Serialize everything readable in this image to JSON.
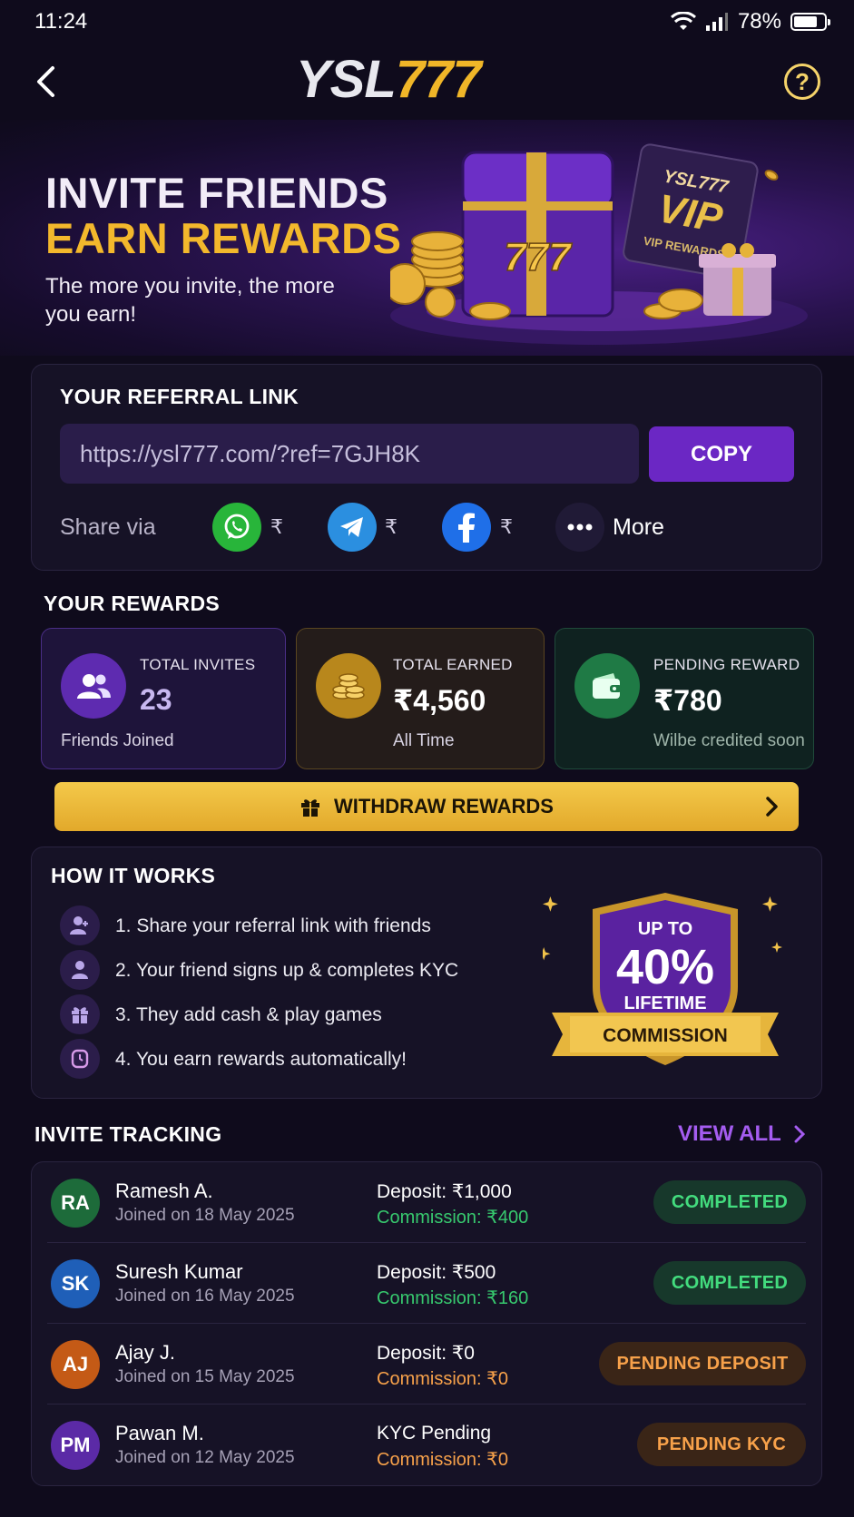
{
  "status_bar": {
    "time": "11:24",
    "battery": "78%",
    "battery_level": 0.78
  },
  "header": {
    "logo_part1": "YSL",
    "logo_part2": "777",
    "help_label": "?"
  },
  "hero": {
    "title_line1": "INVITE FRIENDS",
    "title_line2": "EARN REWARDS",
    "subtitle": "The more you invite, the more you earn!",
    "art_text": {
      "chest": "777",
      "card_brand": "YSL777",
      "card_vip": "VIP",
      "card_sub": "VIP REWARDS"
    }
  },
  "referral": {
    "title": "YOUR REFERRAL LINK",
    "link": "https://ysl777.com/?ref=7GJH8K",
    "copy_label": "COPY",
    "share_label": "Share via",
    "share_tag": "₹",
    "more_label": "More"
  },
  "rewards": {
    "title": "YOUR REWARDS",
    "cards": [
      {
        "label": "TOTAL INVITES",
        "value": "23",
        "foot": "Friends Joined"
      },
      {
        "label": "TOTAL EARNED",
        "value": "₹4,560",
        "foot": "All Time"
      },
      {
        "label": "PENDING REWARD",
        "value": "₹780",
        "foot": "Wilbe credited soon"
      }
    ],
    "withdraw_label": "WITHDRAW REWARDS"
  },
  "how": {
    "title": "HOW IT WORKS",
    "steps": [
      "1. Share your referral link with friends",
      "2. Your friend signs up & completes KYC",
      "3. They add cash & play games",
      "4. You earn rewards automatically!"
    ],
    "badge": {
      "top": "UP TO",
      "percent": "40%",
      "lifetime": "LIFETIME",
      "commission": "COMMISSION"
    }
  },
  "tracking": {
    "title": "INVITE TRACKING",
    "view_all": "VIEW ALL",
    "rows": [
      {
        "initials": "RA",
        "name": "Ramesh A.",
        "joined": "Joined on 18 May 2025",
        "deposit": "Deposit: ₹1,000",
        "commission": "Commission: ₹400",
        "status": "COMPLETED",
        "avatar_color": "#1d6b3a"
      },
      {
        "initials": "SK",
        "name": "Suresh Kumar",
        "joined": "Joined on 16 May 2025",
        "deposit": "Deposit: ₹500",
        "commission": "Commission: ₹160",
        "status": "COMPLETED",
        "avatar_color": "#1f5fb8"
      },
      {
        "initials": "AJ",
        "name": "Ajay J.",
        "joined": "Joined on 15 May 2025",
        "deposit": "Deposit: ₹0",
        "commission": "Commission: ₹0",
        "status": "PENDING DEPOSIT",
        "avatar_color": "#c45a16"
      },
      {
        "initials": "PM",
        "name": "Pawan M.",
        "joined": "Joined on 12 May 2025",
        "deposit": "KYC Pending",
        "commission": "Commission: ₹0",
        "status": "PENDING KYC",
        "avatar_color": "#5b2aa6"
      }
    ]
  },
  "colors": {
    "accent_purple": "#6b27c4",
    "gold": "#f3b82c",
    "green": "#43dc7e",
    "orange": "#f7a14a",
    "background": "#0f0b1c"
  },
  "icons": [
    "wifi-icon",
    "signal-icon",
    "battery-icon",
    "back-icon",
    "help-icon",
    "whatsapp-icon",
    "telegram-icon",
    "facebook-icon",
    "more-icon",
    "users-icon",
    "coins-icon",
    "wallet-icon",
    "gift-icon",
    "chevron-right-icon",
    "user-add-icon",
    "user-icon",
    "shield-icon"
  ]
}
